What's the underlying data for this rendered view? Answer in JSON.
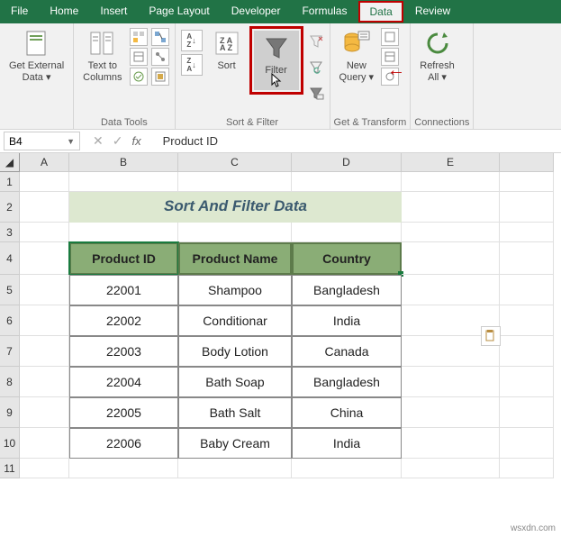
{
  "tabs": [
    "File",
    "Home",
    "Insert",
    "Page Layout",
    "Developer",
    "Formulas",
    "Data",
    "Review"
  ],
  "activeTab": "Data",
  "ribbon": {
    "getExternal": "Get External\nData ▾",
    "textToCols": "Text to\nColumns",
    "dataToolsLabel": "Data Tools",
    "sort": "Sort",
    "filter": "Filter",
    "sortFilterLabel": "Sort & Filter",
    "newQuery": "New\nQuery ▾",
    "getTransformLabel": "Get & Transform",
    "refreshAll": "Refresh\nAll ▾",
    "connectionsLabel": "Connections"
  },
  "nameBox": "B4",
  "formulaValue": "Product ID",
  "columns": [
    "",
    "A",
    "B",
    "C",
    "D",
    "E",
    ""
  ],
  "title": "Sort And Filter Data",
  "headers": [
    "Product ID",
    "Product Name",
    "Country"
  ],
  "rows": [
    {
      "id": "22001",
      "name": "Shampoo",
      "country": "Bangladesh"
    },
    {
      "id": "22002",
      "name": "Conditionar",
      "country": "India"
    },
    {
      "id": "22003",
      "name": "Body Lotion",
      "country": "Canada"
    },
    {
      "id": "22004",
      "name": "Bath Soap",
      "country": "Bangladesh"
    },
    {
      "id": "22005",
      "name": "Bath Salt",
      "country": "China"
    },
    {
      "id": "22006",
      "name": "Baby Cream",
      "country": "India"
    }
  ],
  "watermark": "wsxdn.com"
}
